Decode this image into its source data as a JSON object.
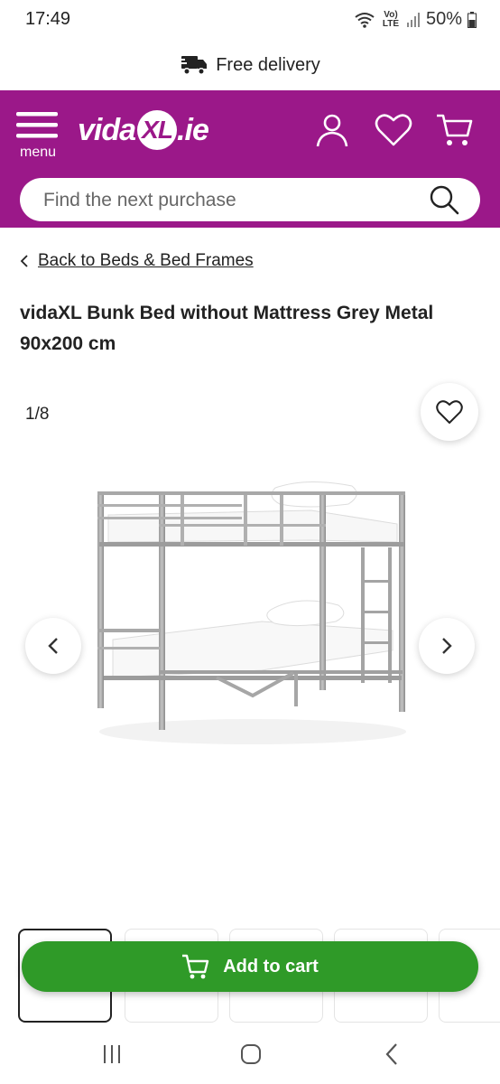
{
  "status_bar": {
    "time": "17:49",
    "network": "Vo) LTE",
    "battery": "50%"
  },
  "delivery": {
    "label": "Free delivery"
  },
  "header": {
    "menu_label": "menu",
    "logo_text_1": "vida",
    "logo_text_xl": "XL",
    "logo_text_2": ".ie",
    "brand_color": "#9b1889",
    "search": {
      "placeholder": "Find the next purchase"
    }
  },
  "breadcrumb": {
    "back_label": "Back to Beds & Bed Frames"
  },
  "product": {
    "title": "vidaXL Bunk Bed without Mattress Grey Metal 90x200 cm",
    "image_counter": "1/8"
  },
  "actions": {
    "add_to_cart": "Add to cart",
    "cart_button_color": "#2f9a28"
  }
}
